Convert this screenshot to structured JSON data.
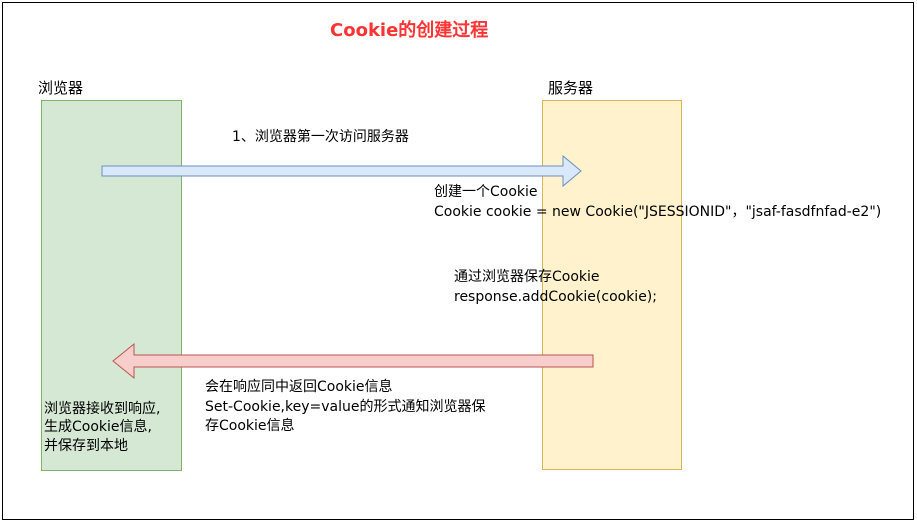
{
  "diagram": {
    "title": "Cookie的创建过程",
    "nodes": {
      "browser": {
        "label": "浏览器",
        "fill": "#d5e8d4",
        "stroke": "#82b366"
      },
      "server": {
        "label": "服务器",
        "fill": "#fff2cc",
        "stroke": "#d6b656"
      }
    },
    "edges": {
      "request": {
        "label": "1、浏览器第一次访问服务器",
        "fill": "#dae8fc",
        "stroke": "#6c8ebf"
      },
      "response": {
        "fill": "#f8cecc",
        "stroke": "#b85450"
      }
    },
    "notes": {
      "create_line1": "创建一个Cookie",
      "create_line2": "Cookie cookie = new Cookie(\"JSESSIONID\"，\"jsaf-fasdfnfad-e2\")",
      "save_line1": "通过浏览器保存Cookie",
      "save_line2": "response.addCookie(cookie);",
      "return_line1": "会在响应同中返回Cookie信息",
      "return_line2": "Set-Cookie,key=value的形式通知浏览器保",
      "return_line3": "存Cookie信息",
      "browser_line1": "浏览器接收到响应,",
      "browser_line2": "生成Cookie信息,",
      "browser_line3": "并保存到本地"
    },
    "title_color": "#ff3333"
  }
}
